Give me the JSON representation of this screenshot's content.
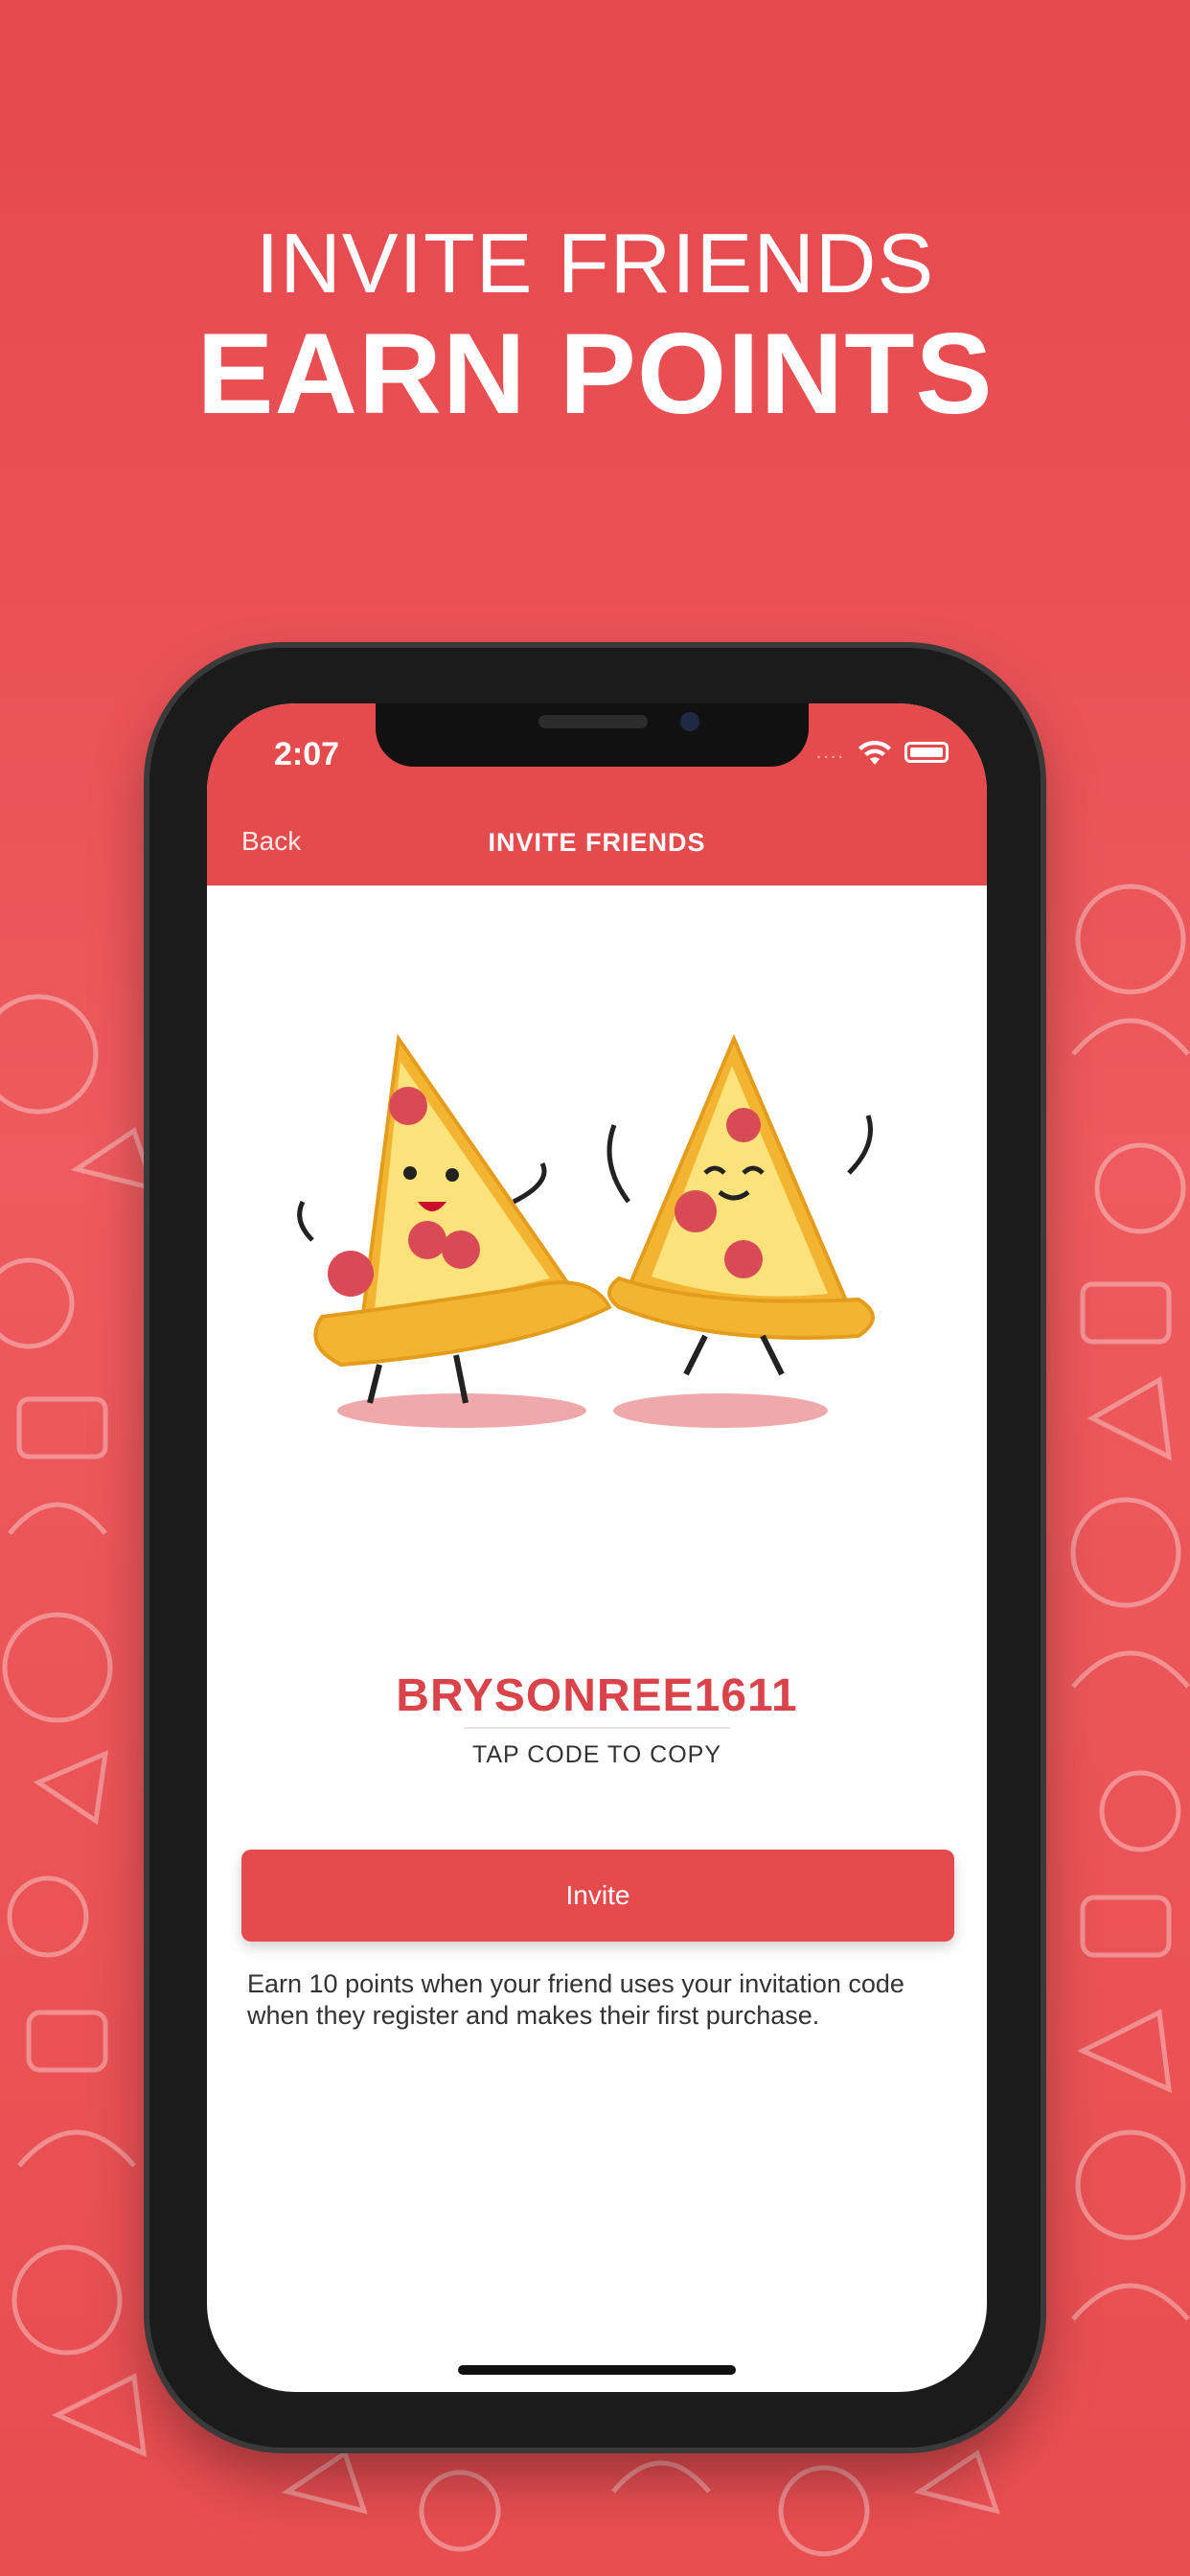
{
  "hero": {
    "line1": "INVITE FRIENDS",
    "line2": "EARN POINTS"
  },
  "status_bar": {
    "time": "2:07",
    "signal": "....",
    "wifi_icon": "wifi-icon",
    "battery_icon": "battery-icon"
  },
  "nav": {
    "back_label": "Back",
    "title": "INVITE FRIENDS"
  },
  "invite": {
    "code": "BRYSONREE1611",
    "tap_hint": "TAP CODE TO COPY",
    "button_label": "Invite",
    "description": "Earn 10 points when your friend uses your invitation code when they register and makes their first purchase."
  },
  "colors": {
    "brand_red": "#e54a4d",
    "code_red": "#d9444a",
    "pizza_crust": "#f3b531",
    "pepperoni": "#d94a57"
  }
}
